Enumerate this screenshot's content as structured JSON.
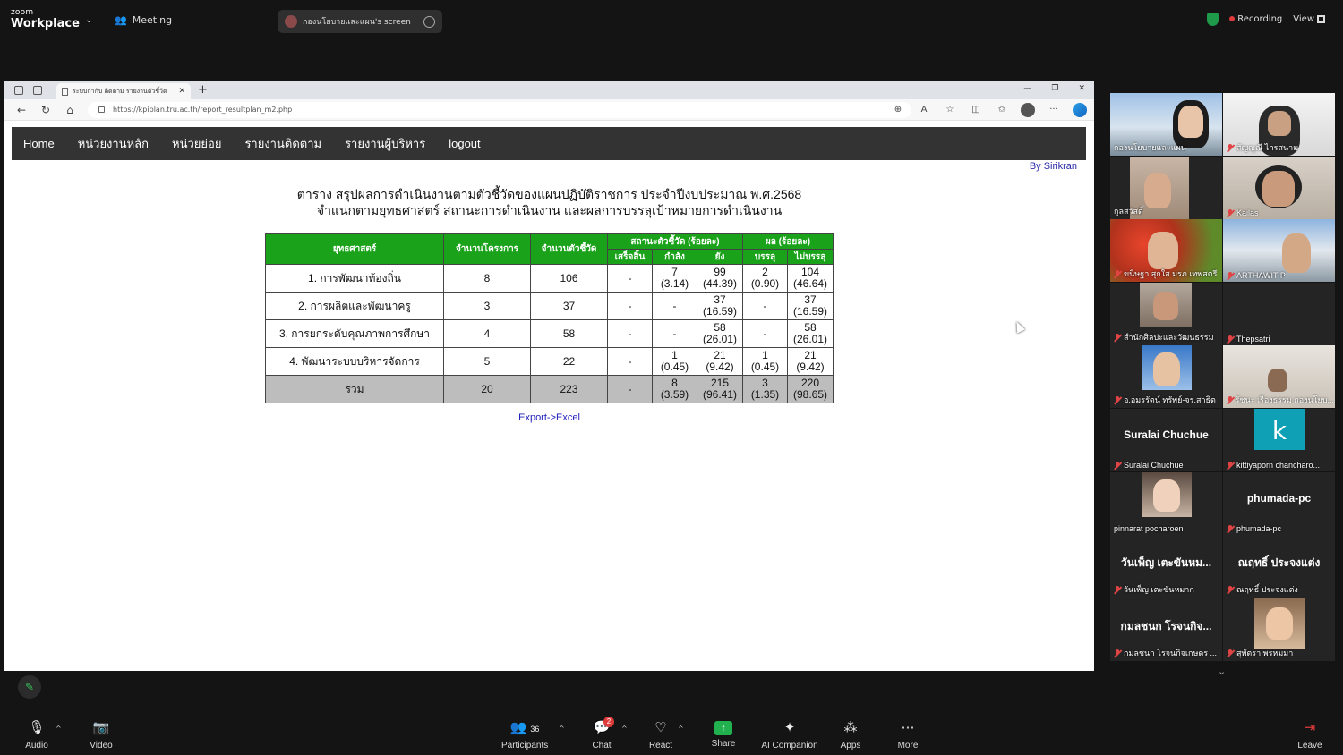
{
  "zoom": {
    "brand_small": "zoom",
    "brand_big": "Workplace",
    "meeting_label": "Meeting",
    "screen_share_label": "กองนโยบายและแผน's screen",
    "recording_label": "Recording",
    "view_label": "View",
    "colors": {
      "recording": "#e03b3b",
      "shield": "#1f9a4a",
      "share": "#21b24f"
    }
  },
  "browser": {
    "tab_title": "ระบบกำกับ ติดตาม รายงานตัวชี้วัด",
    "url": "https://kpiplan.tru.ac.th/report_resultplan_m2.php"
  },
  "site": {
    "menu": [
      "Home",
      "หน่วยงานหลัก",
      "หน่วยย่อย",
      "รายงานติดตาม",
      "รายงานผู้บริหาร",
      "logout"
    ],
    "by": "By Sirikran",
    "title_line1": "ตาราง สรุปผลการดำเนินงานตามตัวชี้วัดของแผนปฏิบัติราชการ ประจำปีงบประมาณ พ.ศ.2568",
    "title_line2": "จำแนกตามยุทธศาสตร์ สถานะการดำเนินงาน และผลการบรรลุเป้าหมายการดำเนินงาน",
    "export_label": "Export->Excel",
    "table": {
      "headers": {
        "strategy": "ยุทธศาสตร์",
        "projects": "จำนวนโครงการ",
        "indicators": "จำนวนตัวชี้วัด",
        "status_group": "สถานะตัวชี้วัด (ร้อยละ)",
        "result_group": "ผล (ร้อยละ)",
        "done": "เสร็จสิ้น",
        "in_progress": "กำลัง",
        "pending": "ยัง",
        "achieved": "บรรลุ",
        "not_achieved": "ไม่บรรลุ"
      },
      "rows": [
        {
          "strategy": "1. การพัฒนาท้องถิ่น",
          "projects": "8",
          "indicators": "106",
          "done": "-",
          "in_progress": "7",
          "in_progress_pct": "(3.14)",
          "pending": "99",
          "pending_pct": "(44.39)",
          "achieved": "2",
          "achieved_pct": "(0.90)",
          "not_achieved": "104",
          "not_achieved_pct": "(46.64)"
        },
        {
          "strategy": "2. การผลิตและพัฒนาครู",
          "projects": "3",
          "indicators": "37",
          "done": "-",
          "in_progress": "-",
          "in_progress_pct": "",
          "pending": "37",
          "pending_pct": "(16.59)",
          "achieved": "-",
          "achieved_pct": "",
          "not_achieved": "37",
          "not_achieved_pct": "(16.59)"
        },
        {
          "strategy": "3. การยกระดับคุณภาพการศึกษา",
          "projects": "4",
          "indicators": "58",
          "done": "-",
          "in_progress": "-",
          "in_progress_pct": "",
          "pending": "58",
          "pending_pct": "(26.01)",
          "achieved": "-",
          "achieved_pct": "",
          "not_achieved": "58",
          "not_achieved_pct": "(26.01)"
        },
        {
          "strategy": "4. พัฒนาระบบบริหารจัดการ",
          "projects": "5",
          "indicators": "22",
          "done": "-",
          "in_progress": "1",
          "in_progress_pct": "(0.45)",
          "pending": "21",
          "pending_pct": "(9.42)",
          "achieved": "1",
          "achieved_pct": "(0.45)",
          "not_achieved": "21",
          "not_achieved_pct": "(9.42)"
        }
      ],
      "total": {
        "strategy": "รวม",
        "projects": "20",
        "indicators": "223",
        "done": "-",
        "in_progress": "8",
        "in_progress_pct": "(3.59)",
        "pending": "215",
        "pending_pct": "(96.41)",
        "achieved": "3",
        "achieved_pct": "(1.35)",
        "not_achieved": "220",
        "not_achieved_pct": "(98.65)"
      },
      "colors": {
        "header": "#1aa31a",
        "total_row": "#bdbdbd"
      }
    }
  },
  "participants": [
    {
      "name": "กองนโยบายและแผน",
      "big": ""
    },
    {
      "name": "สัญญูณี ไกรสนาม",
      "big": ""
    },
    {
      "name": "กุลสวัสดิ์",
      "big": ""
    },
    {
      "name": "Kailas",
      "big": ""
    },
    {
      "name": "ขนิษฐา สุกใส มรภ.เทพสตรี",
      "big": ""
    },
    {
      "name": "ARTHAWIT P",
      "big": ""
    },
    {
      "name": "สำนักศิลปะและวัฒนธรรม",
      "big": ""
    },
    {
      "name": "Thepsatri",
      "big": ""
    },
    {
      "name": "อ.อมรรัตน์ ทรัพย์-จร.สาธิต",
      "big": ""
    },
    {
      "name": "รัชนะ เรืองธรรม กองนโยบ...",
      "big": ""
    },
    {
      "name": "Suralai Chuchue",
      "big": "Suralai Chuchue"
    },
    {
      "name": "kittiyaporn chancharo...",
      "big": ""
    },
    {
      "name": "pinnarat pocharoen",
      "big": ""
    },
    {
      "name": "phumada-pc",
      "big": "phumada-pc"
    },
    {
      "name": "วันเพ็ญ เตะขันหมาก",
      "big": "วันเพ็ญ เตะขันหม..."
    },
    {
      "name": "ณฤทธิ์ ประจงแต่ง",
      "big": "ณฤทธิ์ ประจงแต่ง"
    },
    {
      "name": "กมลชนก โรจนกิจเกษตร ...",
      "big": "กมลชนก โรจนกิจ..."
    },
    {
      "name": "สุพัตรา พรหมมา",
      "big": ""
    }
  ],
  "k_avatar_letter": "k",
  "toolbar": {
    "audio": "Audio",
    "video": "Video",
    "participants": "Participants",
    "participants_count": "36",
    "chat": "Chat",
    "chat_badge": "2",
    "react": "React",
    "share": "Share",
    "ai": "AI Companion",
    "apps": "Apps",
    "more": "More",
    "leave": "Leave"
  }
}
